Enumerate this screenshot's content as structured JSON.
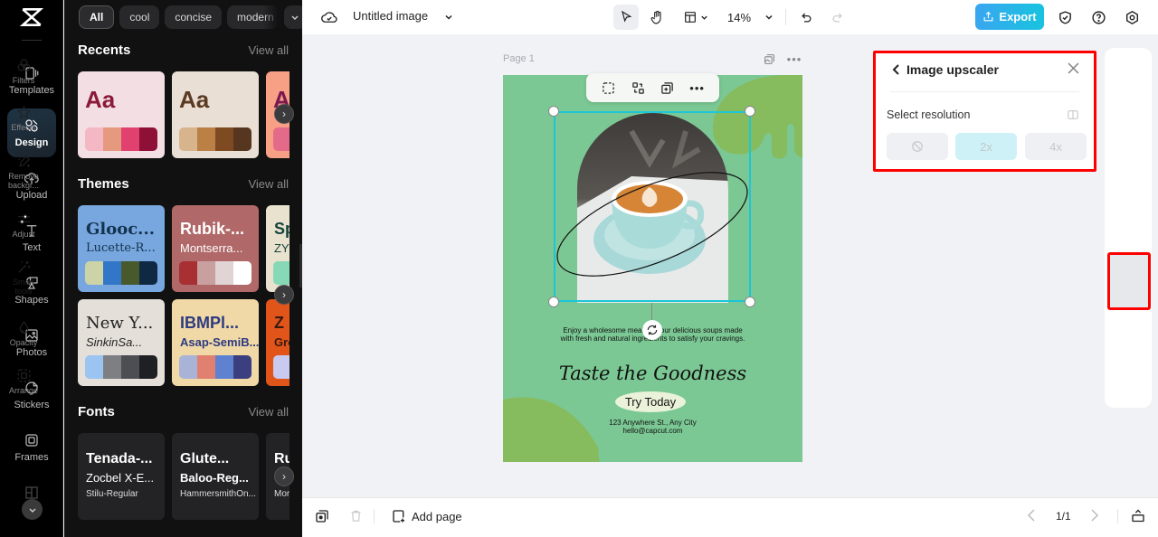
{
  "app": {
    "logo": "capcut-logo"
  },
  "rail": {
    "items": [
      {
        "label": "Templates",
        "icon": "templates-icon"
      },
      {
        "label": "Design",
        "icon": "design-icon",
        "active": true
      },
      {
        "label": "Upload",
        "icon": "upload-icon"
      },
      {
        "label": "Text",
        "icon": "text-icon"
      },
      {
        "label": "Shapes",
        "icon": "shapes-icon"
      },
      {
        "label": "Photos",
        "icon": "photos-icon"
      },
      {
        "label": "Stickers",
        "icon": "stickers-icon"
      },
      {
        "label": "Frames",
        "icon": "frames-icon"
      }
    ]
  },
  "panel": {
    "chips": [
      "All",
      "cool",
      "concise",
      "modern"
    ],
    "recents": {
      "title": "Recents",
      "view_all": "View all",
      "cards": [
        {
          "label": "Aa",
          "bg": "#f3dfe3",
          "fg": "#8a1a3a",
          "palette": [
            "#f4b7c4",
            "#e59a7f",
            "#e0416e",
            "#8e1036"
          ]
        },
        {
          "label": "Aa",
          "bg": "#e9dfd4",
          "fg": "#5a3a22",
          "palette": [
            "#d8b48c",
            "#bb8046",
            "#7e4a21",
            "#573620"
          ]
        },
        {
          "label": "A",
          "bg": "#f7a085",
          "fg": "#7a1850",
          "palette": [
            "#e46a8a"
          ]
        }
      ]
    },
    "themes": {
      "title": "Themes",
      "view_all": "View all",
      "cards": [
        {
          "t1": "Glooc...",
          "t2": "Lucette-R...",
          "bg": "#78a6de",
          "fg": "#12334e",
          "palette": [
            "#cbd3a7",
            "#3276c8",
            "#485a2c",
            "#0e2941"
          ]
        },
        {
          "t1": "Rubik-...",
          "t2": "Montserra...",
          "bg": "#b06868",
          "fg": "#ffffff",
          "palette": [
            "#a82f32",
            "#c9a0a0",
            "#e0d4d4",
            "#ffffff"
          ]
        },
        {
          "t1": "Sp",
          "t2": "ZY",
          "bg": "#e9e2cf",
          "fg": "#14453a",
          "palette": [
            "#86d8b6"
          ]
        },
        {
          "t1": "New Y...",
          "t2": "SinkinSa...",
          "bg": "#e4dfd9",
          "fg": "#222222",
          "palette": [
            "#9cc4f0",
            "#7d7f83",
            "#4c4e53",
            "#1e2024"
          ]
        },
        {
          "t1": "IBMPl...",
          "t2": "Asap-SemiB...",
          "bg": "#f0d9a6",
          "fg": "#2d3a80",
          "palette": [
            "#a9b3d8",
            "#e08070",
            "#5e82d0",
            "#3b3f80"
          ]
        },
        {
          "t1": "Z",
          "t2": "Gro",
          "bg": "#e2551a",
          "fg": "#3a1a10",
          "palette": [
            "#c9caef"
          ]
        }
      ]
    },
    "fonts": {
      "title": "Fonts",
      "view_all": "View all",
      "cards": [
        {
          "f1": "Tenada-...",
          "f2": "Zocbel X-E...",
          "f3": "Stilu-Regular"
        },
        {
          "f1": "Glute...",
          "f2": "Baloo-Reg...",
          "f3": "HammersmithOn..."
        },
        {
          "f1": "Ru",
          "f2": "",
          "f3": "Mor"
        }
      ]
    }
  },
  "topbar": {
    "title": "Untitled image",
    "zoom": "14%",
    "export": "Export"
  },
  "canvas": {
    "page_label": "Page 1",
    "body_text": "Enjoy a wholesome meal with our delicious soups made with fresh and natural ingredients to satisfy your cravings.",
    "headline": "Taste the Goodness",
    "cta": "Try Today",
    "address": "123 Anywhere St., Any City",
    "email": "hello@capcut.com",
    "colors": {
      "bg": "#7bc894",
      "blob": "#86bb5e"
    }
  },
  "upscaler": {
    "title": "Image upscaler",
    "select_label": "Select resolution",
    "options": [
      "",
      "2x",
      "4x"
    ],
    "selected": "2x"
  },
  "right_tools": [
    "Filters",
    "Effects",
    "Remove backgr...",
    "Adjust",
    "Smart tools",
    "Opacity",
    "Arrange"
  ],
  "bottom": {
    "add_page": "Add page",
    "page_indicator": "1/1"
  }
}
